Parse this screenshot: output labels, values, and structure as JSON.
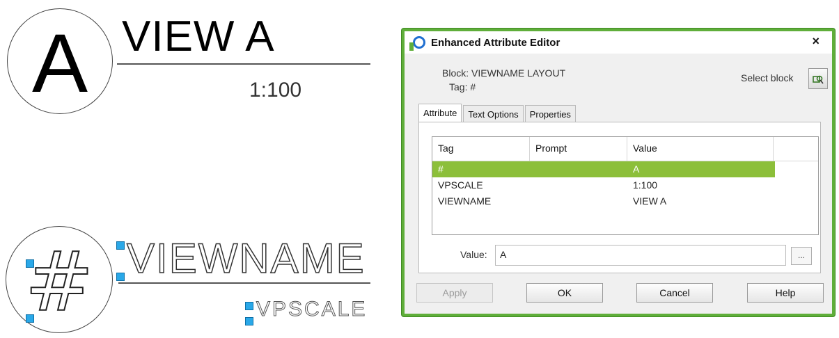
{
  "drawing": {
    "bubble_a_letter": "A",
    "view_title": "VIEW A",
    "view_scale": "1:100",
    "bubble_attr_letter": "#",
    "attr_view_name": "VIEWNAME",
    "attr_scale": "VPSCALE"
  },
  "dialog": {
    "title": "Enhanced Attribute Editor",
    "close_glyph": "×",
    "block_label": "Block: VIEWNAME LAYOUT",
    "tag_label": "Tag: #",
    "select_block_label": "Select block",
    "tabs": [
      {
        "label": "Attribute",
        "active": true
      },
      {
        "label": "Text Options",
        "active": false
      },
      {
        "label": "Properties",
        "active": false
      }
    ],
    "grid": {
      "headers": [
        "Tag",
        "Prompt",
        "Value"
      ],
      "rows": [
        {
          "tag": "#",
          "prompt": "",
          "value": "A",
          "selected": true
        },
        {
          "tag": "VPSCALE",
          "prompt": "",
          "value": "1:100",
          "selected": false
        },
        {
          "tag": "VIEWNAME",
          "prompt": "",
          "value": "VIEW A",
          "selected": false
        }
      ]
    },
    "value_label": "Value:",
    "value_input": "A",
    "ellipsis_label": "...",
    "buttons": {
      "apply": "Apply",
      "ok": "OK",
      "cancel": "Cancel",
      "help": "Help"
    },
    "accent_color": "#5fae3a",
    "selection_color": "#8cbf3a"
  }
}
